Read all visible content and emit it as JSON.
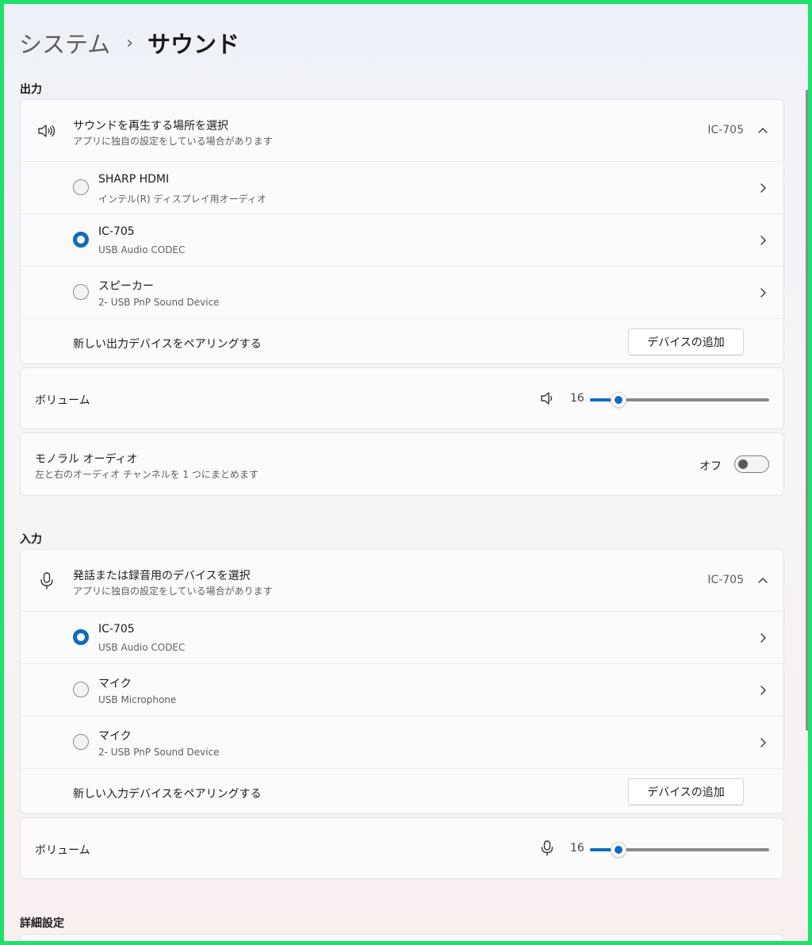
{
  "breadcrumb": {
    "parent": "システム",
    "separator": "›",
    "current": "サウンド"
  },
  "output": {
    "section_title": "出力",
    "selector": {
      "icon": "speaker-icon",
      "title": "サウンドを再生する場所を選択",
      "subtitle": "アプリに独自の設定をしている場合があります",
      "value": "IC-705"
    },
    "devices": [
      {
        "name": "SHARP HDMI",
        "description": "インテル(R) ディスプレイ用オーディオ",
        "selected": false
      },
      {
        "name": "IC-705",
        "description": "USB Audio CODEC",
        "selected": true
      },
      {
        "name": "スピーカー",
        "description": "2- USB PnP Sound Device",
        "selected": false
      }
    ],
    "pair": {
      "label": "新しい出力デバイスをペアリングする",
      "button_label": "デバイスの追加"
    },
    "volume": {
      "label": "ボリューム",
      "icon": "speaker-icon",
      "value": "16",
      "level_percent": 16
    },
    "mono": {
      "title": "モノラル オーディオ",
      "description": "左と右のオーディオ チャンネルを 1 つにまとめます",
      "state_label": "オフ",
      "on": false
    }
  },
  "input": {
    "section_title": "入力",
    "selector": {
      "icon": "microphone-icon",
      "title": "発話または録音用のデバイスを選択",
      "subtitle": "アプリに独自の設定をしている場合があります",
      "value": "IC-705"
    },
    "devices": [
      {
        "name": "IC-705",
        "description": "USB Audio CODEC",
        "selected": true
      },
      {
        "name": "マイク",
        "description": "USB Microphone",
        "selected": false
      },
      {
        "name": "マイク",
        "description": "2- USB PnP Sound Device",
        "selected": false
      }
    ],
    "pair": {
      "label": "新しい入力デバイスをペアリングする",
      "button_label": "デバイスの追加"
    },
    "volume": {
      "label": "ボリューム",
      "icon": "microphone-icon",
      "value": "16",
      "level_percent": 16
    }
  },
  "advanced": {
    "section_title": "詳細設定"
  },
  "colors": {
    "accent": "#0f6cbd",
    "window_border": "#1ee06a"
  }
}
